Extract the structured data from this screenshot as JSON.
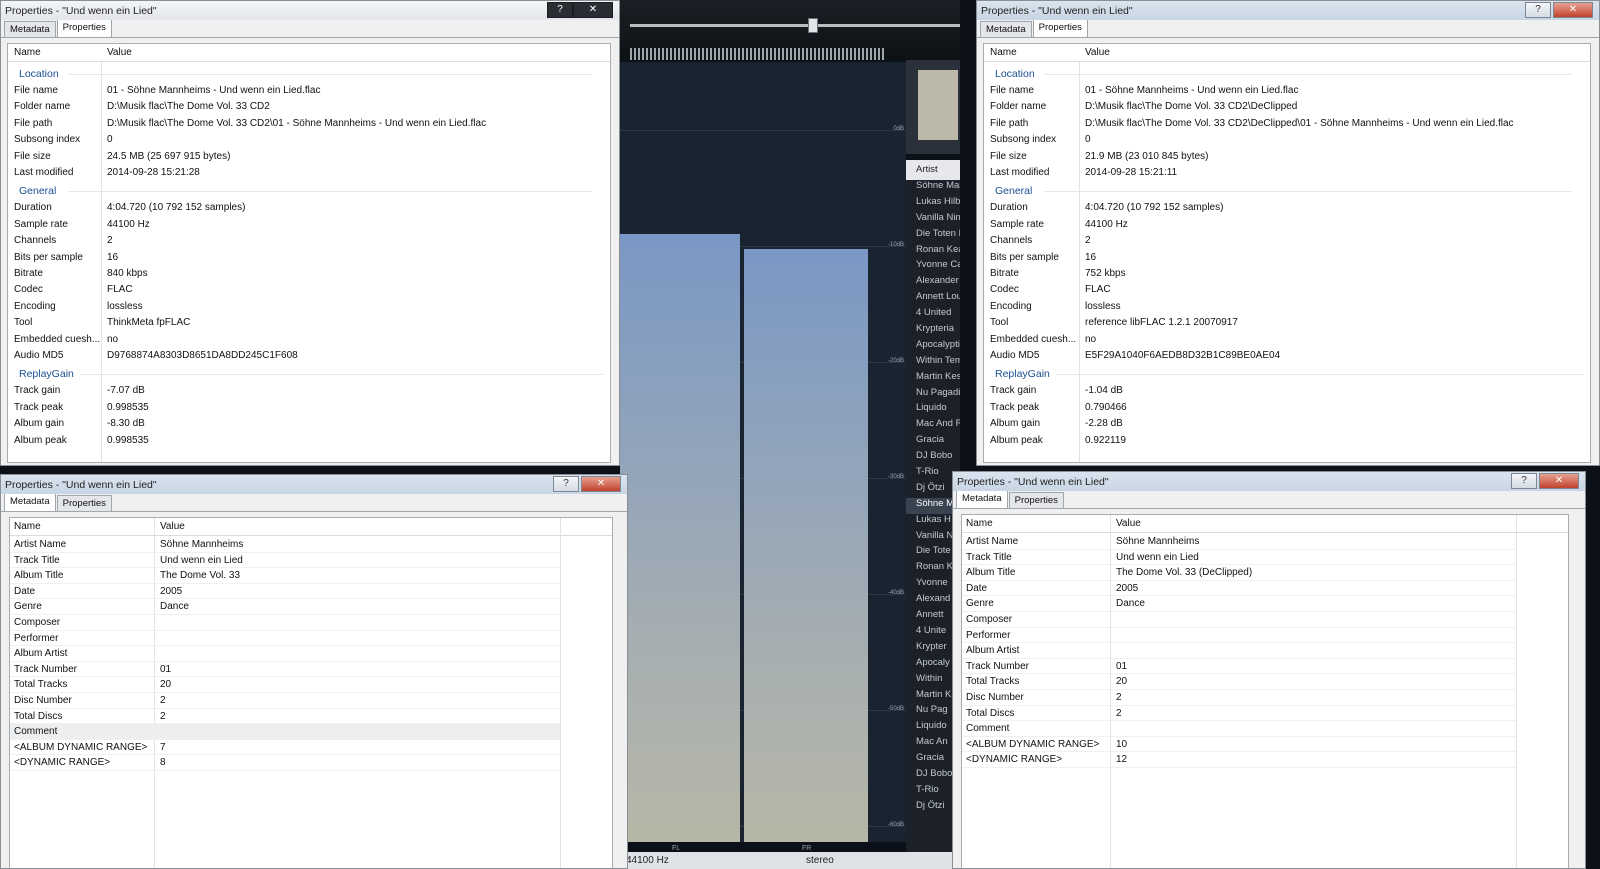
{
  "player": {
    "samplerate_status": "44100 Hz",
    "channels_status": "stereo",
    "db_labels": [
      "0dB",
      "-10dB",
      "-20dB",
      "-30dB",
      "-40dB",
      "-50dB",
      "-60dB"
    ],
    "channel_labels": [
      "FL",
      "FR"
    ],
    "right_labels": [
      "FL",
      "FR",
      "-60dB"
    ],
    "artist_header": "Artist",
    "artists": [
      "Söhne Mannheims",
      "Lukas Hilbert",
      "Vanilla Ninja",
      "Die Toten Hosen",
      "Ronan Keating",
      "Yvonne Catterfeld",
      "Alexander feat.",
      "Annett Louisan",
      "4 United",
      "Krypteria",
      "Apocalyptica",
      "Within Temptation",
      "Martin Kesici",
      "Nu Pagadi",
      "Liquido",
      "Mac And Reli",
      "Gracia",
      "DJ Bobo",
      "T-Rio",
      "Dj Ötzi",
      "Söhne Mannheims",
      "Lukas Hilbert",
      "Vanilla Ninja",
      "Die Toten Hosen",
      "Ronan Keating",
      "Yvonne Catterfeld",
      "Alexander feat.",
      "Annett Louisan",
      "4 United",
      "Krypteria",
      "Apocalyptica",
      "Within Temptation",
      "Martin Kesici",
      "Nu Pagadi",
      "Liquido",
      "Mac And Reli",
      "Gracia",
      "DJ Bobo",
      "T-Rio",
      "Dj Ötzi"
    ],
    "artist_display": [
      "Söhne Mann",
      "Lukas Hilbert",
      "Vanilla Ninja",
      "Die Toten Ho",
      "Ronan Keatin",
      "Yvonne Catte",
      "Alexander fe",
      "Annett Louis",
      "4 United",
      "Krypteria",
      "Apocalyptica",
      "Within Temp",
      "Martin Kesic",
      "Nu Pagadi",
      "Liquido",
      "Mac And Rel",
      "Gracia",
      "DJ Bobo",
      "T-Rio",
      "Dj Ötzi",
      "Söhne M",
      "Lukas H",
      "Vanilla N",
      "Die Tote",
      "Ronan K",
      "Yvonne",
      "Alexand",
      "Annett",
      "4 Unite",
      "Krypter",
      "Apocaly",
      "Within",
      "Martin K",
      "Nu Pag",
      "Liquido",
      "Mac An",
      "Gracia",
      "DJ Bobo",
      "T-Rio",
      "Dj Ötzi"
    ],
    "spectrum_levels": {
      "FL": 0.78,
      "FR": 0.76
    }
  },
  "prop_left": {
    "title": "Properties - \"Und wenn ein Lied\"",
    "help": "?",
    "close": "✕",
    "tabs": [
      "Metadata",
      "Properties"
    ],
    "col_name": "Name",
    "col_value": "Value",
    "groups": [
      {
        "label": "Location",
        "rows": [
          [
            "File name",
            "01 - Söhne Mannheims - Und wenn ein Lied.flac"
          ],
          [
            "Folder name",
            "D:\\Musik flac\\The Dome Vol. 33 CD2"
          ],
          [
            "File path",
            "D:\\Musik flac\\The Dome Vol. 33 CD2\\01 - Söhne Mannheims - Und wenn ein Lied.flac"
          ],
          [
            "Subsong index",
            "0"
          ],
          [
            "File size",
            "24.5 MB (25 697 915 bytes)"
          ],
          [
            "Last modified",
            "2014-09-28 15:21:28"
          ]
        ]
      },
      {
        "label": "General",
        "rows": [
          [
            "Duration",
            "4:04.720 (10 792 152 samples)"
          ],
          [
            "Sample rate",
            "44100 Hz"
          ],
          [
            "Channels",
            "2"
          ],
          [
            "Bits per sample",
            "16"
          ],
          [
            "Bitrate",
            "840 kbps"
          ],
          [
            "Codec",
            "FLAC"
          ],
          [
            "Encoding",
            "lossless"
          ],
          [
            "Tool",
            "ThinkMeta fpFLAC"
          ],
          [
            "Embedded cuesh...",
            "no"
          ],
          [
            "Audio MD5",
            "D9768874A8303D8651DA8DD245C1F608"
          ]
        ]
      },
      {
        "label": "ReplayGain",
        "rows": [
          [
            "Track gain",
            "-7.07 dB"
          ],
          [
            "Track peak",
            "0.998535"
          ],
          [
            "Album gain",
            "-8.30 dB"
          ],
          [
            "Album peak",
            "0.998535"
          ]
        ]
      }
    ]
  },
  "prop_right": {
    "title": "Properties - \"Und wenn ein Lied\"",
    "help": "?",
    "close": "✕",
    "tabs": [
      "Metadata",
      "Properties"
    ],
    "col_name": "Name",
    "col_value": "Value",
    "groups": [
      {
        "label": "Location",
        "rows": [
          [
            "File name",
            "01 - Söhne Mannheims - Und wenn ein Lied.flac"
          ],
          [
            "Folder name",
            "D:\\Musik flac\\The Dome Vol. 33 CD2\\DeClipped"
          ],
          [
            "File path",
            "D:\\Musik flac\\The Dome Vol. 33 CD2\\DeClipped\\01 - Söhne Mannheims - Und wenn ein Lied.flac"
          ],
          [
            "Subsong index",
            "0"
          ],
          [
            "File size",
            "21.9 MB (23 010 845 bytes)"
          ],
          [
            "Last modified",
            "2014-09-28 15:21:11"
          ]
        ]
      },
      {
        "label": "General",
        "rows": [
          [
            "Duration",
            "4:04.720 (10 792 152 samples)"
          ],
          [
            "Sample rate",
            "44100 Hz"
          ],
          [
            "Channels",
            "2"
          ],
          [
            "Bits per sample",
            "16"
          ],
          [
            "Bitrate",
            "752 kbps"
          ],
          [
            "Codec",
            "FLAC"
          ],
          [
            "Encoding",
            "lossless"
          ],
          [
            "Tool",
            "reference libFLAC 1.2.1 20070917"
          ],
          [
            "Embedded cuesh...",
            "no"
          ],
          [
            "Audio MD5",
            "E5F29A1040F6AEDB8D32B1C89BE0AE04"
          ]
        ]
      },
      {
        "label": "ReplayGain",
        "rows": [
          [
            "Track gain",
            "-1.04 dB"
          ],
          [
            "Track peak",
            "0.790466"
          ],
          [
            "Album gain",
            "-2.28 dB"
          ],
          [
            "Album peak",
            "0.922119"
          ]
        ]
      }
    ]
  },
  "meta_left": {
    "title": "Properties - \"Und wenn ein Lied\"",
    "help": "?",
    "close": "✕",
    "tabs": [
      "Metadata",
      "Properties"
    ],
    "col_name": "Name",
    "col_value": "Value",
    "rows": [
      [
        "Artist Name",
        "Söhne Mannheims"
      ],
      [
        "Track Title",
        "Und wenn ein Lied"
      ],
      [
        "Album Title",
        "The Dome Vol. 33"
      ],
      [
        "Date",
        "2005"
      ],
      [
        "Genre",
        "Dance"
      ],
      [
        "Composer",
        ""
      ],
      [
        "Performer",
        ""
      ],
      [
        "Album Artist",
        ""
      ],
      [
        "Track Number",
        "01"
      ],
      [
        "Total Tracks",
        "20"
      ],
      [
        "Disc Number",
        "2"
      ],
      [
        "Total Discs",
        "2"
      ],
      [
        "Comment",
        ""
      ],
      [
        "<ALBUM DYNAMIC RANGE>",
        "7"
      ],
      [
        "<DYNAMIC RANGE>",
        "8"
      ]
    ]
  },
  "meta_right": {
    "title": "Properties - \"Und wenn ein Lied\"",
    "help": "?",
    "close": "✕",
    "tabs": [
      "Metadata",
      "Properties"
    ],
    "col_name": "Name",
    "col_value": "Value",
    "rows": [
      [
        "Artist Name",
        "Söhne Mannheims"
      ],
      [
        "Track Title",
        "Und wenn ein Lied"
      ],
      [
        "Album Title",
        "The Dome Vol. 33 (DeClipped)"
      ],
      [
        "Date",
        "2005"
      ],
      [
        "Genre",
        "Dance"
      ],
      [
        "Composer",
        ""
      ],
      [
        "Performer",
        ""
      ],
      [
        "Album Artist",
        ""
      ],
      [
        "Track Number",
        "01"
      ],
      [
        "Total Tracks",
        "20"
      ],
      [
        "Disc Number",
        "2"
      ],
      [
        "Total Discs",
        "2"
      ],
      [
        "Comment",
        ""
      ],
      [
        "<ALBUM DYNAMIC RANGE>",
        "10"
      ],
      [
        "<DYNAMIC RANGE>",
        "12"
      ]
    ]
  }
}
